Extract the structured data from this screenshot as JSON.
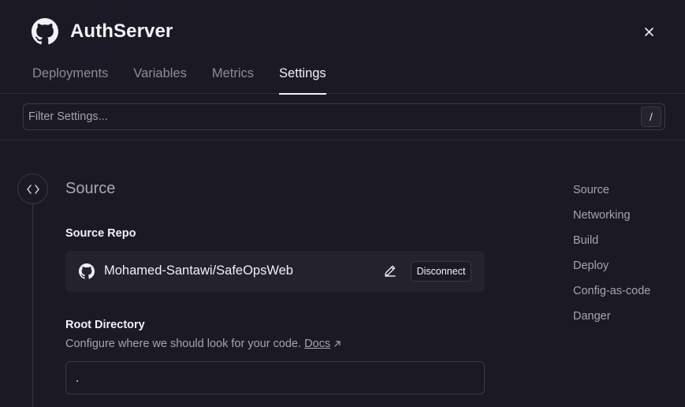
{
  "app": {
    "title": "AuthServer",
    "logo_icon": "github-icon",
    "close_icon": "close-icon"
  },
  "tabs": [
    {
      "label": "Deployments",
      "active": false
    },
    {
      "label": "Variables",
      "active": false
    },
    {
      "label": "Metrics",
      "active": false
    },
    {
      "label": "Settings",
      "active": true
    }
  ],
  "filter": {
    "placeholder": "Filter Settings...",
    "value": "",
    "shortcut": "/"
  },
  "section": {
    "icon": "code-icon",
    "title": "Source",
    "source_repo": {
      "label": "Source Repo",
      "repo_icon": "github-icon",
      "name": "Mohamed-Santawi/SafeOpsWeb",
      "edit_icon": "pencil-icon",
      "disconnect_label": "Disconnect"
    },
    "root_directory": {
      "label": "Root Directory",
      "help_text": "Configure where we should look for your code.",
      "docs_label": "Docs",
      "docs_icon": "external-link-icon",
      "value": "."
    }
  },
  "toc": [
    "Source",
    "Networking",
    "Build",
    "Deploy",
    "Config-as-code",
    "Danger"
  ],
  "colors": {
    "background": "#1b1a24",
    "card": "#23222d",
    "border": "#3a3946",
    "muted_text": "#a5a4ae",
    "text": "#f2f2f5"
  }
}
